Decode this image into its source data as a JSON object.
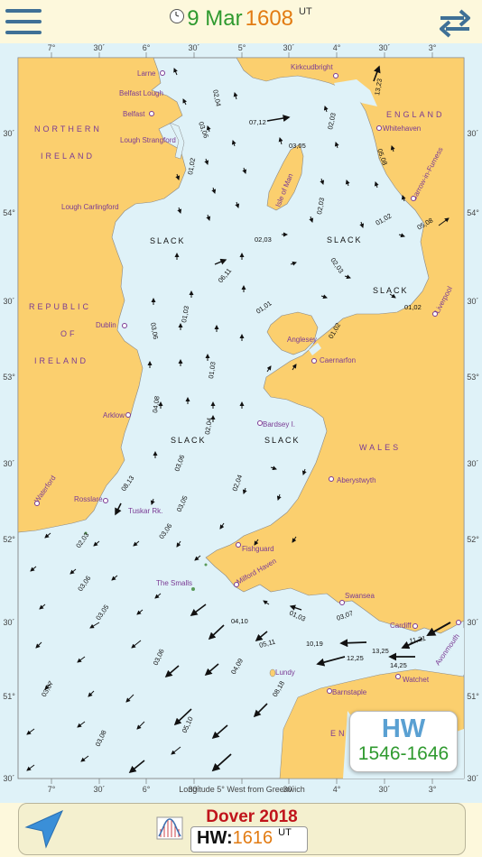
{
  "header": {
    "date": "9 Mar",
    "time": "1608",
    "time_suffix": "UT",
    "menu_icon": "hamburger-icon",
    "swap_icon": "swap-arrows-icon",
    "clock_icon": "clock-icon"
  },
  "map": {
    "top_ticks": [
      "7°",
      "30´",
      "6°",
      "30´",
      "5°",
      "30´",
      "4°",
      "30´",
      "3°"
    ],
    "bottom_ticks": [
      "7°",
      "30´",
      "6°",
      "30´",
      "5°",
      "30´",
      "4°",
      "30´",
      "3°"
    ],
    "left_ticks": [
      "30´",
      "54°",
      "30´",
      "53°",
      "30´",
      "52°",
      "30´",
      "51°",
      "30´"
    ],
    "right_ticks": [
      "30´",
      "54°",
      "30´",
      "53°",
      "30´",
      "52°",
      "30´",
      "51°",
      "30´"
    ],
    "longitude_caption": "Longitude 5° West from Greenwich",
    "region_labels": [
      "NORTHERN",
      "IRELAND",
      "REPUBLIC",
      "OF",
      "IRELAND",
      "ENGLAND",
      "WALES",
      "EN"
    ],
    "place_labels": [
      "Larne",
      "Belfast Lough",
      "Belfast",
      "Lough Strangford",
      "Lough Carlingford",
      "Kirkcudbright",
      "Whitehaven",
      "Isle of Man",
      "Barrow-in-Furness",
      "Liverpool",
      "Dublin",
      "Anglesey",
      "Caernarfon",
      "Arklow",
      "Bardsey I.",
      "Aberystwyth",
      "Waterford",
      "Rosslare",
      "Tuskar Rk.",
      "Fishguard",
      "The Smalls",
      "Milford Haven",
      "Swansea",
      "Cardiff",
      "Avonmouth",
      "Watchet",
      "Lundy",
      "Barnstaple"
    ],
    "slack_labels": [
      "SLACK",
      "SLACK",
      "SLACK",
      "SLACK",
      "SLACK"
    ],
    "rate_labels": [
      "02,04",
      "07,12",
      "03,06",
      "03,05",
      "02,03",
      "13,23",
      "05,08",
      "01,02",
      "02,03",
      "02,03",
      "01,02",
      "05,08",
      "06,11",
      "02,03",
      "01,03",
      "01,01",
      "01,02",
      "01,02",
      "03,06",
      "01,03",
      "04,08",
      "02,04",
      "02,04",
      "03,06",
      "03,05",
      "08,13",
      "03,06",
      "02,03",
      "03,06",
      "03,05",
      "01,03",
      "03,07",
      "04,10",
      "10,19",
      "11,21",
      "05,11",
      "13,25",
      "14,25",
      "12,25",
      "03,06",
      "04,09",
      "03,07",
      "08,18",
      "05,10",
      "03,08"
    ]
  },
  "hw_box": {
    "title": "HW",
    "range": "1546-1646"
  },
  "footer": {
    "port": "Dover 2018",
    "hw_label": "HW:",
    "hw_time": "1616",
    "hw_suffix": "UT",
    "nav_icon": "location-arrow-icon",
    "tide_icon": "tide-curve-icon"
  },
  "colors": {
    "land": "#fbcf6e",
    "sea": "#dff2f8",
    "place_text": "#7a3a94",
    "date_green": "#2f9a2f",
    "time_orange": "#e27b12",
    "hw_blue": "#5aa0d2",
    "port_red": "#c0141b",
    "menu_blue": "#3f7096"
  }
}
